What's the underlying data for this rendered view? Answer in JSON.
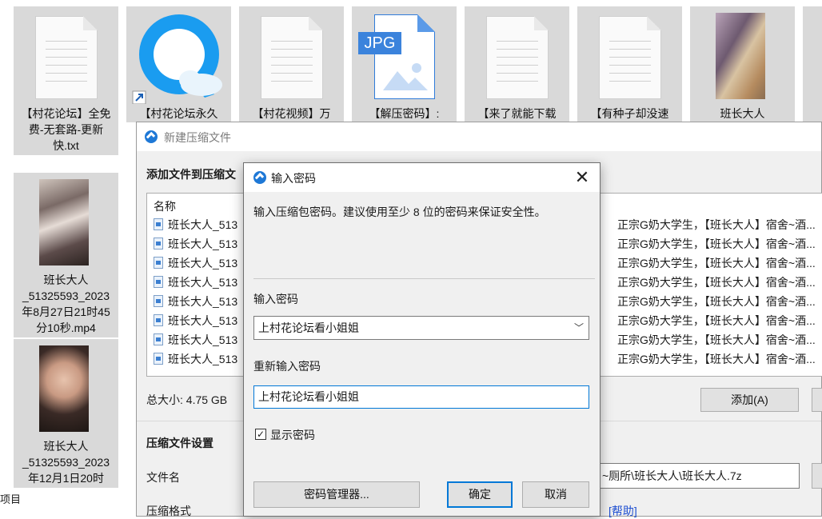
{
  "desktop": {
    "files": [
      {
        "icon": "text-file-icon",
        "label": "【村花论坛】全免费-无套路-更新快.txt"
      },
      {
        "icon": "browser-shortcut-icon",
        "label": "【村花论坛永久"
      },
      {
        "icon": "text-file-icon",
        "label": "【村花视频】万"
      },
      {
        "icon": "jpg-file-icon",
        "jpg_text": "JPG",
        "label": "【解压密码】:"
      },
      {
        "icon": "text-file-icon",
        "label": "【来了就能下载"
      },
      {
        "icon": "text-file-icon",
        "label": "【有种子却没速"
      },
      {
        "icon": "video-thumbnail",
        "label": "班长大人"
      },
      {
        "icon": "video-thumbnail",
        "label": "班长大人_51325593_2023年8月27日21时45分10秒.mp4"
      },
      {
        "icon": "video-thumbnail",
        "label": "班长大人_51325593_2023年12月1日20时"
      }
    ],
    "status_text": "项目"
  },
  "archive_dialog": {
    "title": "新建压缩文件",
    "section_add": "添加文件到压缩文",
    "column_name": "名称",
    "rows": [
      {
        "name": "班长大人_513",
        "desc": "正宗G奶大学生，【班长大人】宿舍~酒..."
      },
      {
        "name": "班长大人_513",
        "desc": "正宗G奶大学生，【班长大人】宿舍~酒..."
      },
      {
        "name": "班长大人_513",
        "desc": "正宗G奶大学生，【班长大人】宿舍~酒..."
      },
      {
        "name": "班长大人_513",
        "desc": "正宗G奶大学生，【班长大人】宿舍~酒..."
      },
      {
        "name": "班长大人_513",
        "desc": "正宗G奶大学生，【班长大人】宿舍~酒..."
      },
      {
        "name": "班长大人_513",
        "desc": "正宗G奶大学生，【班长大人】宿舍~酒..."
      },
      {
        "name": "班长大人_513",
        "desc": "正宗G奶大学生，【班长大人】宿舍~酒..."
      },
      {
        "name": "班长大人_513",
        "desc": "正宗G奶大学生，【班长大人】宿舍~酒..."
      }
    ],
    "total_size": "总大小: 4.75 GB",
    "add_button": "添加(A)",
    "settings_heading": "压缩文件设置",
    "filename_label": "文件名",
    "filename_value": "~厕所\\班长大人\\班长大人.7z",
    "format_label": "压缩格式",
    "help_link": "[帮助]"
  },
  "password_dialog": {
    "title": "输入密码",
    "instruction": "输入压缩包密码。建议使用至少 8 位的密码来保证安全性。",
    "password_label": "输入密码",
    "password_value": "上村花论坛看小姐姐",
    "reenter_label": "重新输入密码",
    "reenter_value": "上村花论坛看小姐姐",
    "show_password_label": "显示密码",
    "show_password_checked": true,
    "check_glyph": "✓",
    "manager_button": "密码管理器...",
    "ok_button": "确定",
    "cancel_button": "取消",
    "close_glyph": "✕",
    "dropdown_glyph": "﹀"
  },
  "colors": {
    "accent": "#0078d7",
    "link": "#1f4fd1",
    "dialog_bg": "#f0f0f0",
    "tile_bg": "#d9d9d9"
  }
}
